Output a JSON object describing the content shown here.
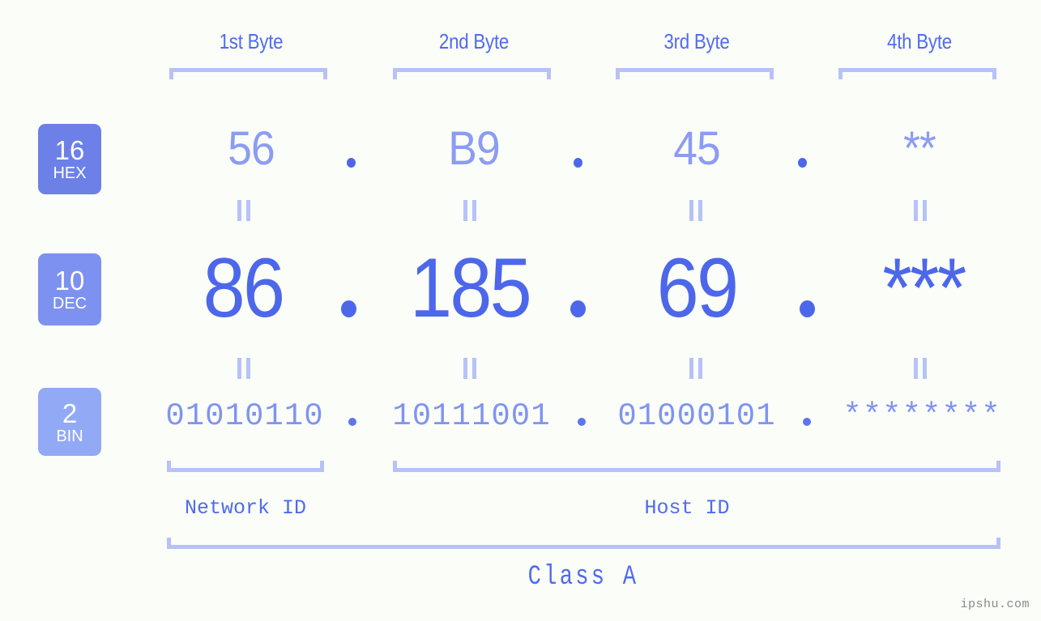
{
  "watermark": "ipshu.com",
  "class_label": "Class A",
  "headers": [
    {
      "label": "1st Byte"
    },
    {
      "label": "2nd Byte"
    },
    {
      "label": "3rd Byte"
    },
    {
      "label": "4th Byte"
    }
  ],
  "radix_badges": [
    {
      "number": "16",
      "name": "HEX",
      "color": "#6c80e8"
    },
    {
      "number": "10",
      "name": "DEC",
      "color": "#7d91f0"
    },
    {
      "number": "2",
      "name": "BIN",
      "color": "#92a9f5"
    }
  ],
  "rows": {
    "hex": {
      "radix": "16",
      "values": [
        "56",
        "B9",
        "45",
        "**"
      ],
      "separator": "."
    },
    "dec": {
      "radix": "10",
      "values": [
        "86",
        "185",
        "69",
        "***"
      ],
      "separator": "."
    },
    "bin": {
      "radix": "2",
      "values": [
        "01010110",
        "10111001",
        "01000101",
        "********"
      ],
      "separator": "."
    }
  },
  "equals_marks": {
    "symbol": "||",
    "count_per_row": 4
  },
  "id_sections": [
    {
      "label": "Network ID"
    },
    {
      "label": "Host ID"
    }
  ],
  "colors": {
    "background": "#fbfdf8",
    "accent_strong": "#4d67ea",
    "accent_mid": "#7f94f0",
    "accent_light": "#b6c2f8",
    "header_text": "#4f6bf0",
    "watermark_text": "#8a8a8a"
  }
}
